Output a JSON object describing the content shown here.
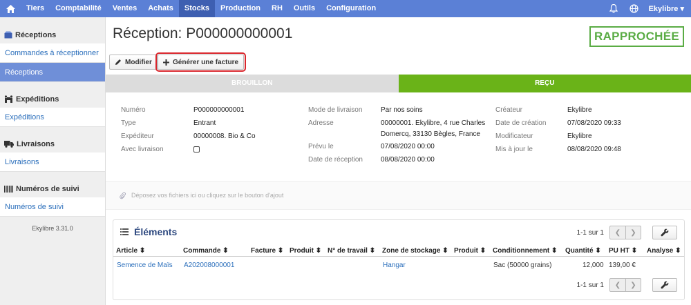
{
  "nav": {
    "items": [
      "Tiers",
      "Comptabilité",
      "Ventes",
      "Achats",
      "Stocks",
      "Production",
      "RH",
      "Outils",
      "Configuration"
    ],
    "active": "Stocks",
    "user": "Ekylibre"
  },
  "sidebar": {
    "sections": [
      {
        "title": "Réceptions",
        "items": [
          "Commandes à réceptionner",
          "Réceptions"
        ]
      },
      {
        "title": "Expéditions",
        "items": [
          "Expéditions"
        ]
      },
      {
        "title": "Livraisons",
        "items": [
          "Livraisons"
        ]
      },
      {
        "title": "Numéros de suivi",
        "items": [
          "Numéros de suivi"
        ]
      }
    ],
    "version": "Ekylibre 3.31.0"
  },
  "page": {
    "title": "Réception: P000000000001",
    "status": "RAPPROCHÉE",
    "modify_label": "Modifier",
    "invoice_label": "Générer une facture"
  },
  "steps": {
    "draft": "BROUILLON",
    "received": "REÇU"
  },
  "details": {
    "col1": [
      {
        "label": "Numéro",
        "value": "P000000000001"
      },
      {
        "label": "Type",
        "value": "Entrant"
      },
      {
        "label": "Expéditeur",
        "value": "00000008. Bio & Co"
      },
      {
        "label": "Avec livraison",
        "value": ""
      }
    ],
    "col2": {
      "delivery_mode_label": "Mode de livraison",
      "delivery_mode": "Par nos soins",
      "address_label": "Adresse",
      "address_line1": "00000001. Ekylibre, 4 rue Charles",
      "address_line2": "Domercq, 33130 Bègles, France",
      "planned_label": "Prévu le",
      "planned": "07/08/2020 00:00",
      "received_label": "Date de réception",
      "received": "08/08/2020 00:00"
    },
    "col3": [
      {
        "label": "Créateur",
        "value": "Ekylibre"
      },
      {
        "label": "Date de création",
        "value": "07/08/2020 09:33"
      },
      {
        "label": "Modificateur",
        "value": "Ekylibre"
      },
      {
        "label": "Mis à jour le",
        "value": "08/08/2020 09:48"
      }
    ]
  },
  "dropzone": "Déposez vos fichiers ici ou cliquez sur le bouton d'ajout",
  "elements": {
    "title": "Éléments",
    "pagination": "1-1 sur 1",
    "columns": [
      "Article",
      "Commande",
      "Facture",
      "Produit",
      "N° de travail",
      "Zone de stockage",
      "Produit",
      "Conditionnement",
      "Quantité",
      "PU HT",
      "Analyse"
    ],
    "row": {
      "article": "Semence de Maïs",
      "order": "A202008000001",
      "zone": "Hangar",
      "packaging": "Sac (50000 grains)",
      "quantity": "12,000",
      "price": "139,00 €"
    }
  }
}
